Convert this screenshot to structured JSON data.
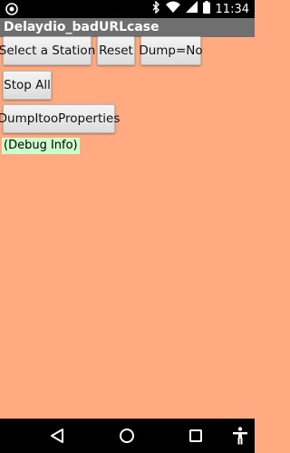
{
  "status_bar": {
    "time": "11:34",
    "icons": [
      "notification-icon",
      "bluetooth-icon",
      "wifi-icon",
      "signal-icon",
      "battery-icon"
    ]
  },
  "app": {
    "title": "Delaydio_badURLcase"
  },
  "buttons": {
    "select_station": "Select a Station",
    "reset": "Reset",
    "dump": "Dump=No",
    "stop_all": "Stop All",
    "dump_props": "DumpItooProperties"
  },
  "debug": {
    "text": "(Debug Info)"
  },
  "colors": {
    "background": "#ffaa80",
    "title_bar": "#6f6f6f",
    "debug_bg": "#ccffcc"
  },
  "nav_bar": {
    "icons": [
      "back-icon",
      "home-icon",
      "recent-apps-icon",
      "accessibility-icon"
    ]
  }
}
